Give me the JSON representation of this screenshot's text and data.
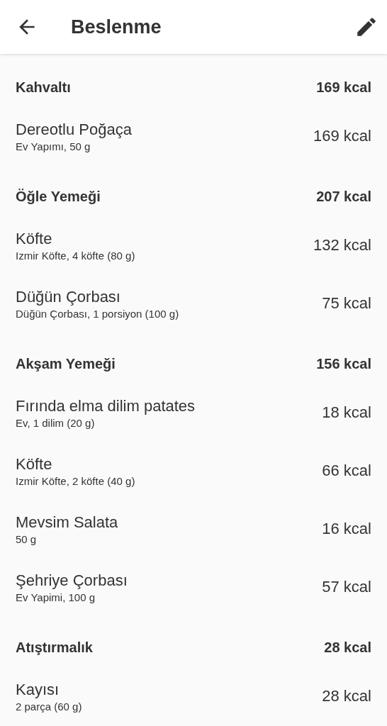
{
  "header": {
    "title": "Beslenme"
  },
  "meals": [
    {
      "name": "Kahvaltı",
      "total": "169 kcal",
      "items": [
        {
          "name": "Dereotlu Poğaça",
          "detail": "Ev Yapımı, 50 g",
          "kcal": "169 kcal"
        }
      ]
    },
    {
      "name": "Öğle Yemeği",
      "total": "207 kcal",
      "items": [
        {
          "name": "Köfte",
          "detail": "Izmir Köfte, 4 köfte (80 g)",
          "kcal": "132 kcal"
        },
        {
          "name": "Düğün Çorbası",
          "detail": "Düğün Çorbası, 1 porsiyon (100 g)",
          "kcal": "75 kcal"
        }
      ]
    },
    {
      "name": "Akşam Yemeği",
      "total": "156 kcal",
      "items": [
        {
          "name": "Fırında elma dilim patates",
          "detail": "Ev, 1 dilim (20 g)",
          "kcal": "18 kcal"
        },
        {
          "name": "Köfte",
          "detail": "Izmir Köfte, 2 köfte (40 g)",
          "kcal": "66 kcal"
        },
        {
          "name": "Mevsim Salata",
          "detail": "50 g",
          "kcal": "16 kcal"
        },
        {
          "name": "Şehriye Çorbası",
          "detail": "Ev Yapimi, 100 g",
          "kcal": "57 kcal"
        }
      ]
    },
    {
      "name": "Atıştırmalık",
      "total": "28 kcal",
      "items": [
        {
          "name": "Kayısı",
          "detail": "2 parça (60 g)",
          "kcal": "28 kcal"
        }
      ]
    }
  ]
}
